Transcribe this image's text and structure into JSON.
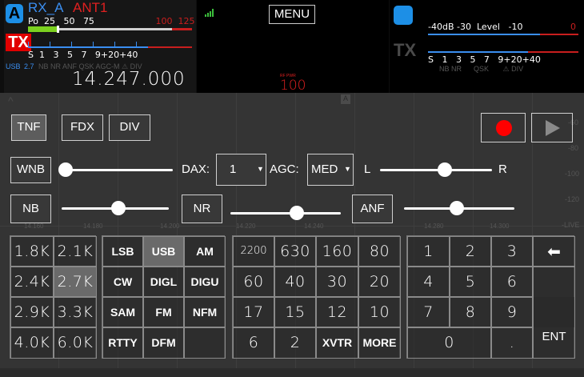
{
  "left_meter": {
    "rx_label": "RX_A",
    "ant_label": "ANT1",
    "badge": "A",
    "tx_badge": "TX",
    "po_scale": "Po  25   50   75",
    "po_scale_red": " 100  125",
    "s_scale": "S  1   3   5   7   9+20+40",
    "mode": "USB",
    "bandwidth": "2.7",
    "flags": "NB NR ANF QSK AGC-M ⚠ DIV",
    "frequency": "14.247.000"
  },
  "mid_panel": {
    "menu_label": "MENU",
    "rf_power_label": "RF PWR",
    "rf_power_value": "100"
  },
  "right_meter": {
    "tx_badge": "TX",
    "level_scale": "-40dB -30  Level   -10",
    "level_scale_red": "0",
    "s_scale": "S   1   3   5   7   9+20+40",
    "flags": "NB NR      QSK       ⚠ DIV"
  },
  "controls": {
    "tnf": "TNF",
    "fdx": "FDX",
    "div": "DIV",
    "wnb": "WNB",
    "dax_label": "DAX:",
    "dax_value": "1",
    "agc_label": "AGC:",
    "agc_value": "MED",
    "pan_l": "L",
    "pan_r": "R",
    "nb": "NB",
    "nr": "NR",
    "anf": "ANF",
    "wnb_level": 0.0,
    "pan_level": 0.58,
    "nb_level": 0.53,
    "nr_level": 0.6,
    "anf_level": 0.48
  },
  "filters": [
    "1.8K",
    "2.1K",
    "2.4K",
    "2.7K",
    "2.9K",
    "3.3K",
    "4.0K",
    "6.0K"
  ],
  "filter_selected": "2.7K",
  "modes": [
    "LSB",
    "USB",
    "AM",
    "CW",
    "DIGL",
    "DIGU",
    "SAM",
    "FM",
    "NFM",
    "RTTY",
    "DFM",
    ""
  ],
  "mode_selected": "USB",
  "bands": [
    "2200",
    "630",
    "160",
    "80",
    "60",
    "40",
    "30",
    "20",
    "17",
    "15",
    "12",
    "10",
    "6",
    "2",
    "XVTR",
    "MORE"
  ],
  "keypad": [
    "1",
    "2",
    "3",
    "⬅",
    "4",
    "5",
    "6",
    "",
    "7",
    "8",
    "9",
    "ENT",
    "0",
    "."
  ],
  "freq_ticks": [
    "14.160",
    "14.180",
    "14.200",
    "14.220",
    "14.240",
    "14.260",
    "14.280",
    "14.300"
  ],
  "db_ticks": [
    "-60",
    "-80",
    "-100",
    "-120",
    "-LIVE"
  ],
  "colors": {
    "accent": "#1d8fe6",
    "tx_red": "#e10000",
    "record": "#ff0000",
    "meter_green": "#7cd11f",
    "rf_power": "#e02020"
  }
}
